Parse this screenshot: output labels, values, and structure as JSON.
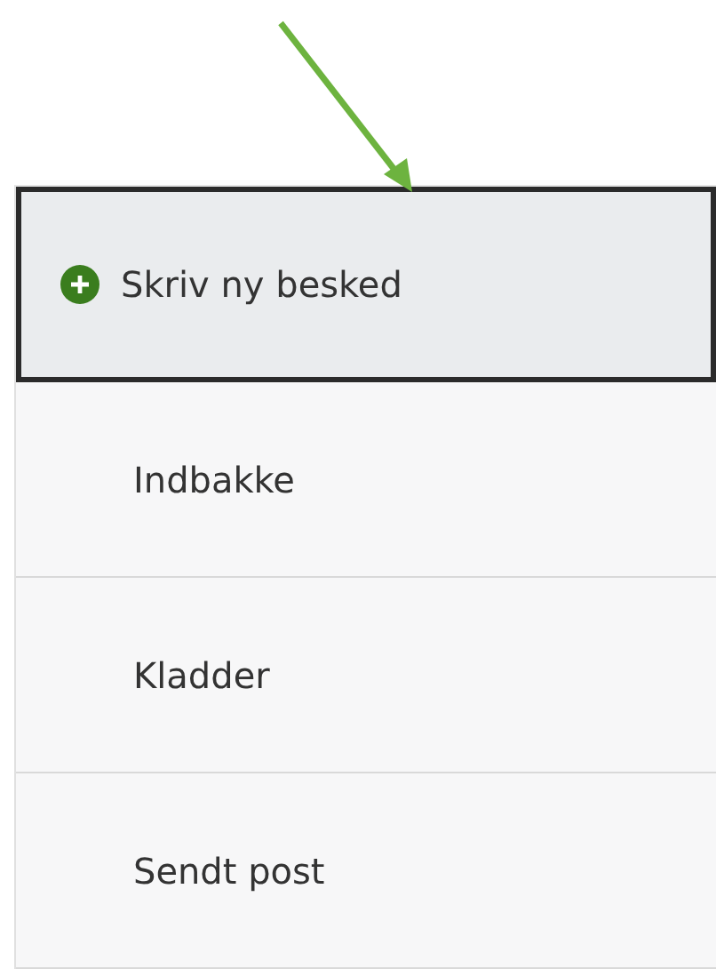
{
  "menu": {
    "items": [
      {
        "label": "Skriv ny besked",
        "kind": "compose",
        "focused": true
      },
      {
        "label": "Indbakke",
        "kind": "folder",
        "focused": false
      },
      {
        "label": "Kladder",
        "kind": "folder",
        "focused": false
      },
      {
        "label": "Sendt post",
        "kind": "folder",
        "focused": false
      }
    ]
  }
}
